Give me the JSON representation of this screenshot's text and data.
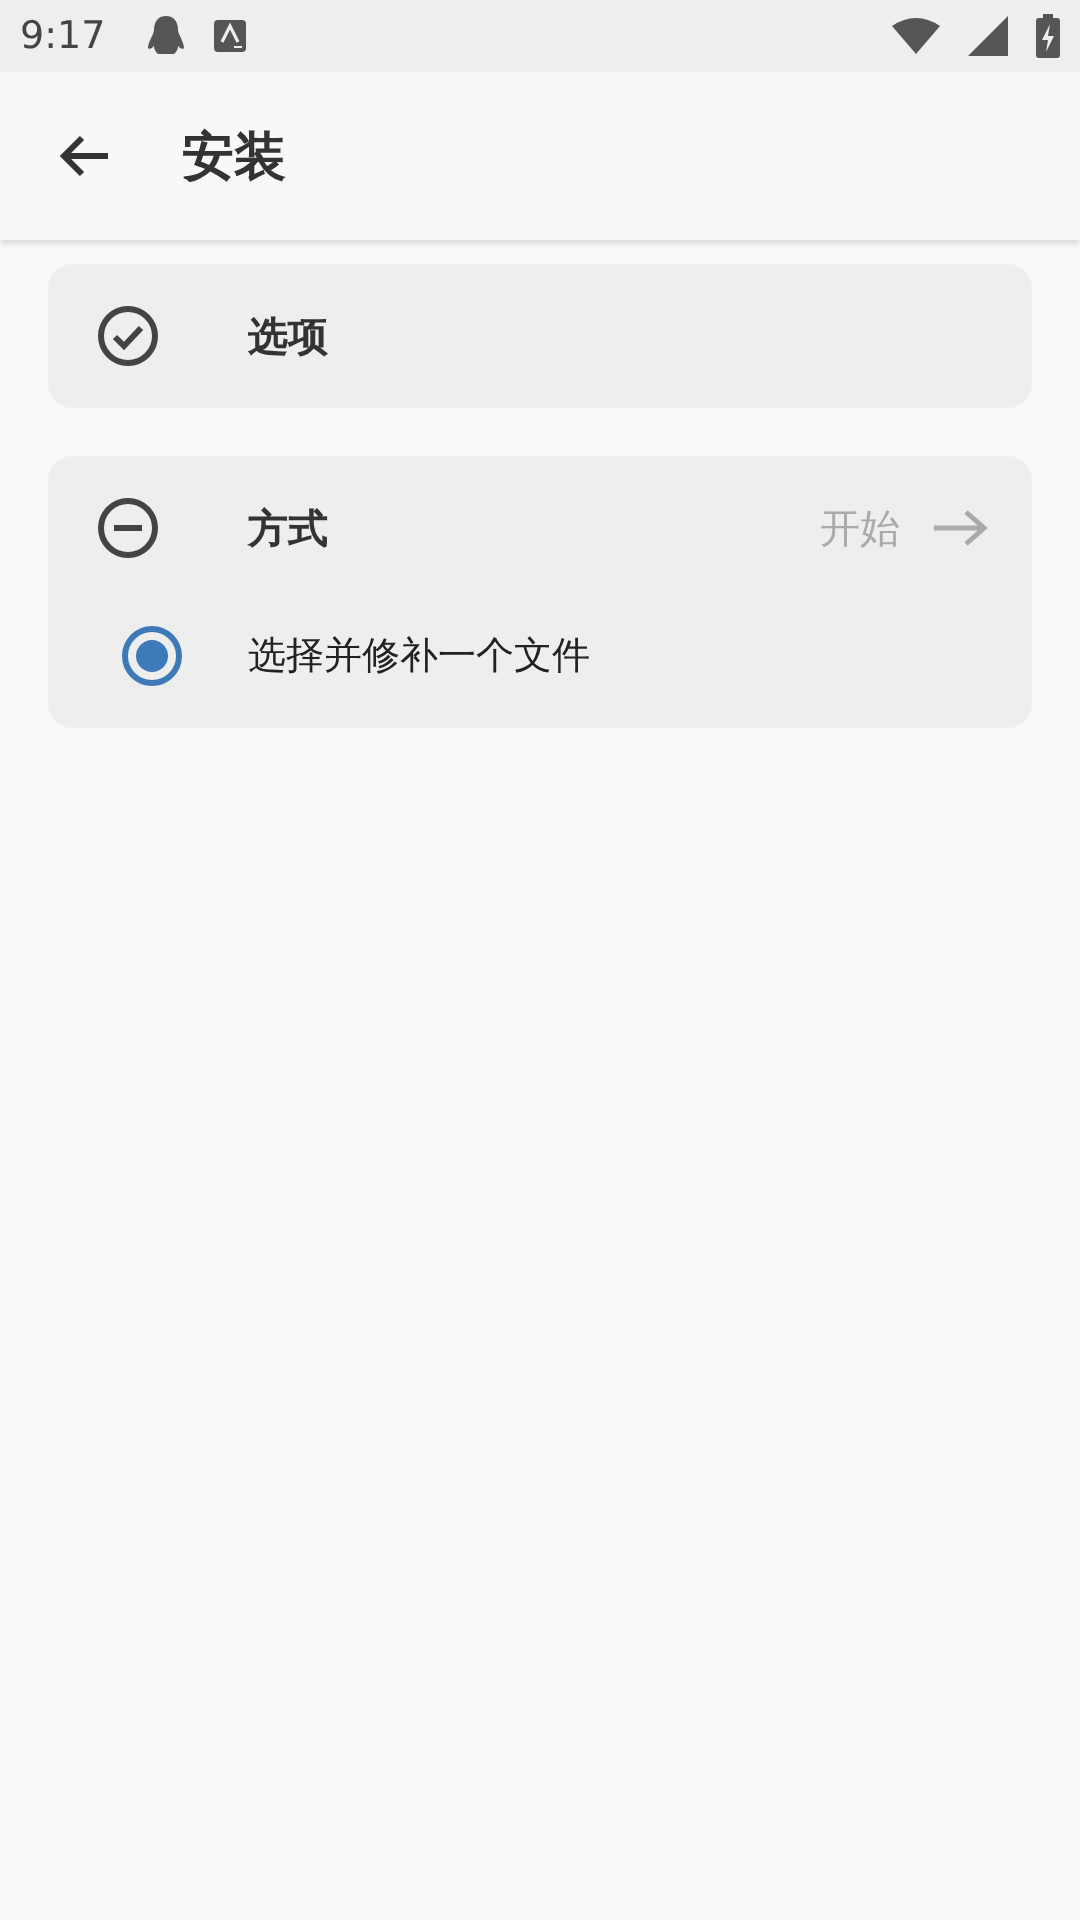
{
  "status_bar": {
    "time": "9:17"
  },
  "app_bar": {
    "title": "安装"
  },
  "steps": [
    {
      "title": "选项",
      "completed": true
    },
    {
      "title": "方式",
      "completed": false,
      "action": "开始",
      "options": [
        {
          "label": "选择并修补一个文件",
          "selected": true
        }
      ]
    }
  ]
}
